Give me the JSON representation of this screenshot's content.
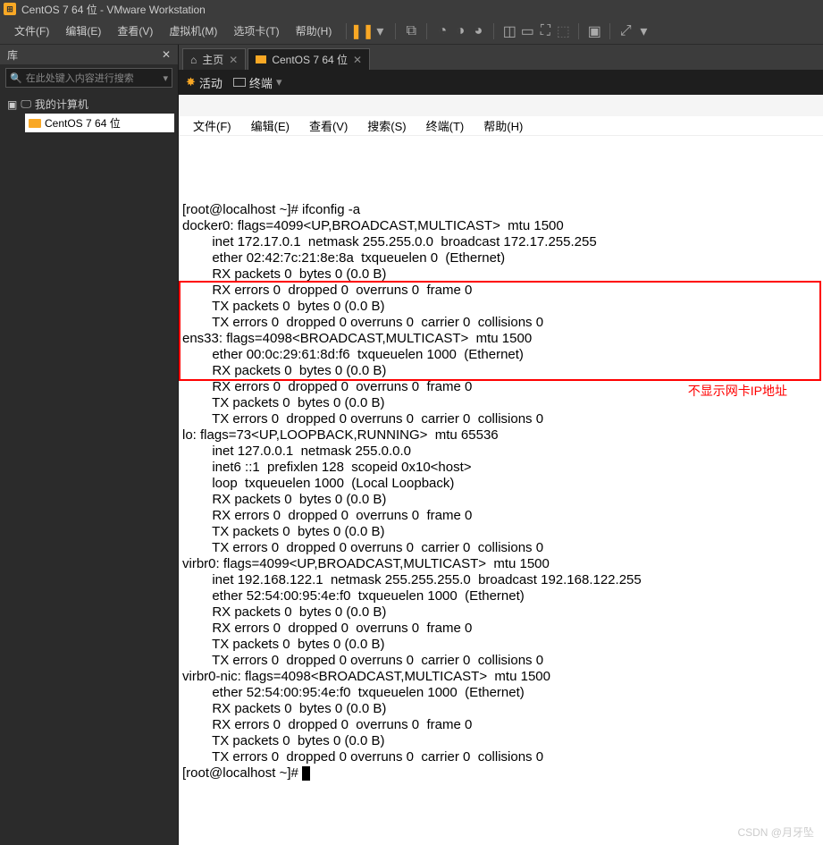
{
  "window": {
    "title": "CentOS 7 64 位 - VMware Workstation"
  },
  "menu": {
    "file": "文件(F)",
    "edit": "编辑(E)",
    "view": "查看(V)",
    "vm": "虚拟机(M)",
    "tabs": "选项卡(T)",
    "help": "帮助(H)"
  },
  "sidebar": {
    "header": "库",
    "search_placeholder": "在此处键入内容进行搜索",
    "root": "我的计算机",
    "vm": "CentOS 7 64 位"
  },
  "tabs": {
    "home": "主页",
    "vm": "CentOS 7 64 位"
  },
  "vmtop": {
    "activities": "活动",
    "terminal": "终端"
  },
  "termmenu": {
    "file": "文件(F)",
    "edit": "编辑(E)",
    "view": "查看(V)",
    "search": "搜索(S)",
    "terminal": "终端(T)",
    "help": "帮助(H)"
  },
  "annotation": "不显示网卡IP地址",
  "watermark": "CSDN @月牙坠",
  "terminal_lines": [
    "[root@localhost ~]# ifconfig -a",
    "docker0: flags=4099<UP,BROADCAST,MULTICAST>  mtu 1500",
    "        inet 172.17.0.1  netmask 255.255.0.0  broadcast 172.17.255.255",
    "        ether 02:42:7c:21:8e:8a  txqueuelen 0  (Ethernet)",
    "        RX packets 0  bytes 0 (0.0 B)",
    "        RX errors 0  dropped 0  overruns 0  frame 0",
    "        TX packets 0  bytes 0 (0.0 B)",
    "        TX errors 0  dropped 0 overruns 0  carrier 0  collisions 0",
    "",
    "ens33: flags=4098<BROADCAST,MULTICAST>  mtu 1500",
    "        ether 00:0c:29:61:8d:f6  txqueuelen 1000  (Ethernet)",
    "        RX packets 0  bytes 0 (0.0 B)",
    "        RX errors 0  dropped 0  overruns 0  frame 0",
    "        TX packets 0  bytes 0 (0.0 B)",
    "        TX errors 0  dropped 0 overruns 0  carrier 0  collisions 0",
    "",
    "lo: flags=73<UP,LOOPBACK,RUNNING>  mtu 65536",
    "        inet 127.0.0.1  netmask 255.0.0.0",
    "        inet6 ::1  prefixlen 128  scopeid 0x10<host>",
    "        loop  txqueuelen 1000  (Local Loopback)",
    "        RX packets 0  bytes 0 (0.0 B)",
    "        RX errors 0  dropped 0  overruns 0  frame 0",
    "        TX packets 0  bytes 0 (0.0 B)",
    "        TX errors 0  dropped 0 overruns 0  carrier 0  collisions 0",
    "",
    "virbr0: flags=4099<UP,BROADCAST,MULTICAST>  mtu 1500",
    "        inet 192.168.122.1  netmask 255.255.255.0  broadcast 192.168.122.255",
    "        ether 52:54:00:95:4e:f0  txqueuelen 1000  (Ethernet)",
    "        RX packets 0  bytes 0 (0.0 B)",
    "        RX errors 0  dropped 0  overruns 0  frame 0",
    "        TX packets 0  bytes 0 (0.0 B)",
    "        TX errors 0  dropped 0 overruns 0  carrier 0  collisions 0",
    "",
    "virbr0-nic: flags=4098<BROADCAST,MULTICAST>  mtu 1500",
    "        ether 52:54:00:95:4e:f0  txqueuelen 1000  (Ethernet)",
    "        RX packets 0  bytes 0 (0.0 B)",
    "        RX errors 0  dropped 0  overruns 0  frame 0",
    "        TX packets 0  bytes 0 (0.0 B)",
    "        TX errors 0  dropped 0 overruns 0  carrier 0  collisions 0",
    "",
    "[root@localhost ~]# "
  ],
  "redbox": {
    "top_line": 9,
    "bottom_line": 14
  }
}
